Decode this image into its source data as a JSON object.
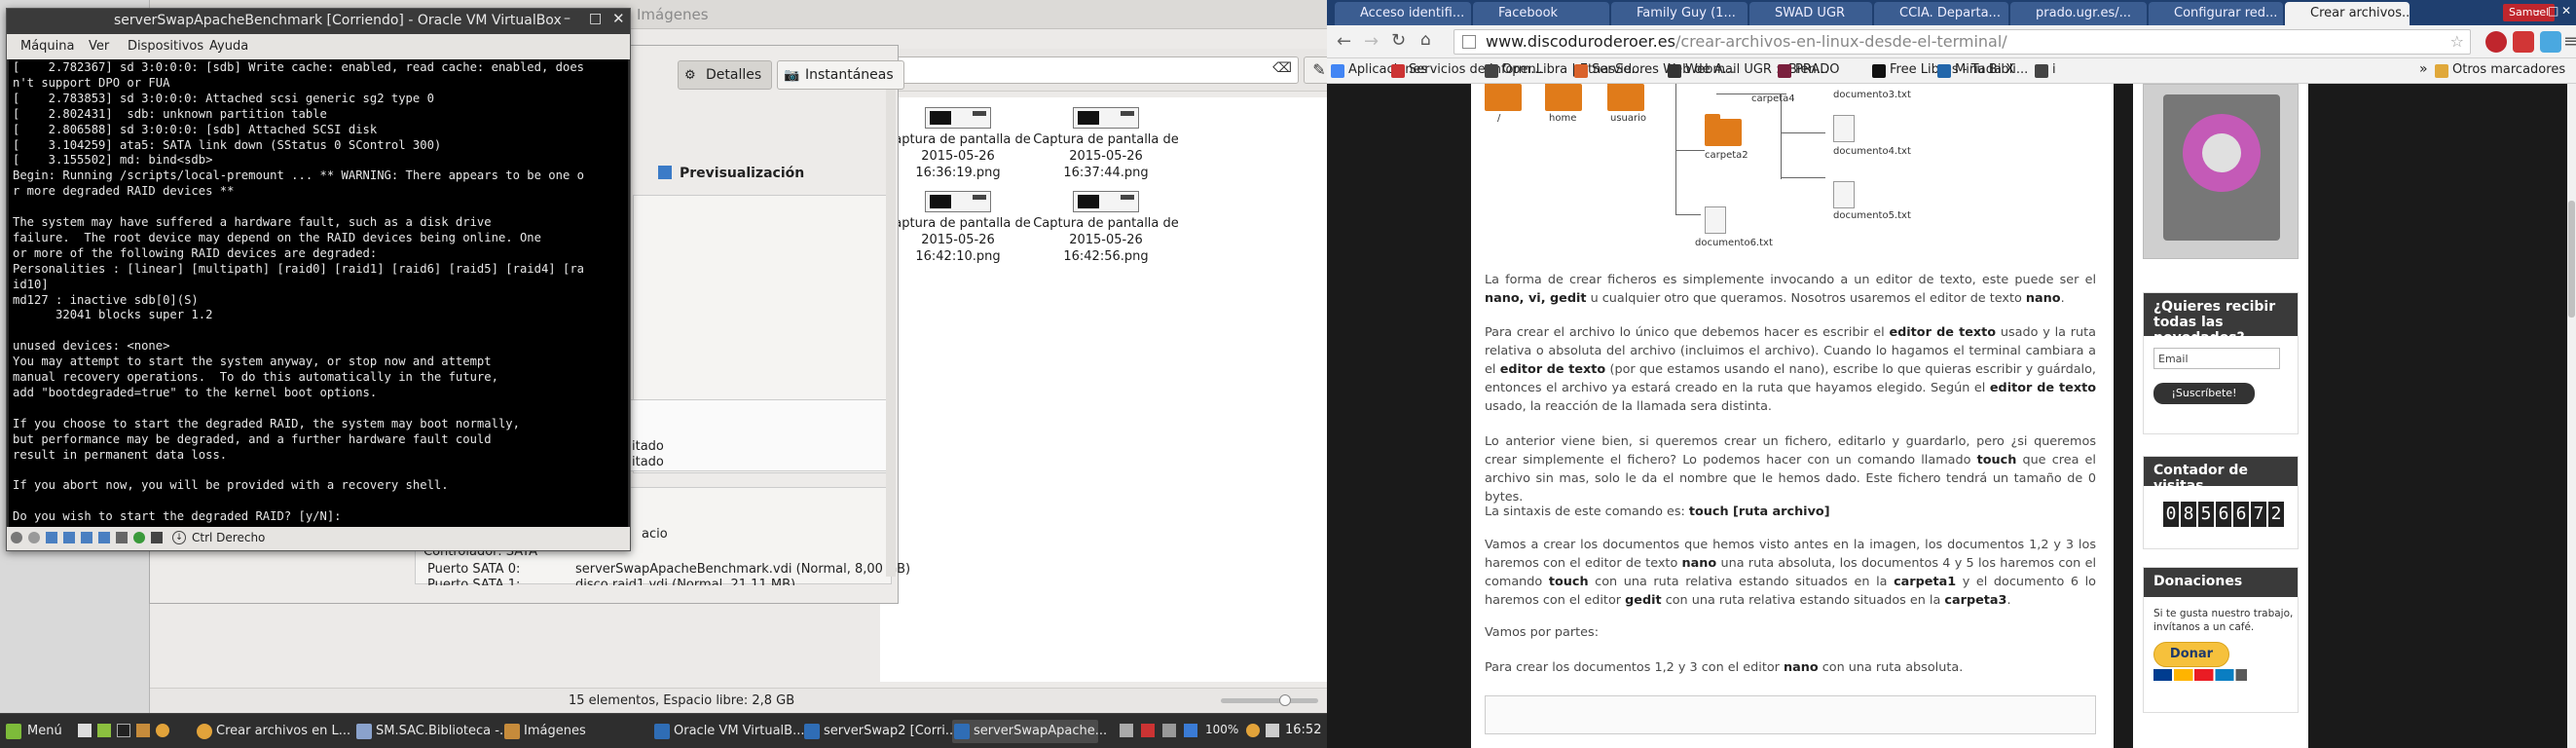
{
  "left_screen": {
    "file_manager": {
      "window_title": "Imágenes",
      "view_buttons": [
        "list-icon",
        "grid-icon",
        "compact-icon"
      ],
      "files": [
        {
          "name": "Captura de pantalla de 2015-05-26 16:36:19.png"
        },
        {
          "name": "Captura de pantalla de 2015-05-26 16:37:44.png"
        },
        {
          "name": "Captura de pantalla de 2015-05-26 16:42:10.png"
        },
        {
          "name": "Captura de pantalla de 2015-05-26 16:42:56.png"
        }
      ],
      "status": "15 elementos, Espacio libre: 2,8 GB"
    },
    "vm_details": {
      "tab_details": "Detalles",
      "tab_snapshots": "Instantáneas",
      "preview_label": "Previsualización",
      "storage": {
        "state1": "itado",
        "state2": "itado",
        "host": "acio",
        "controller": "Controlador: SATA",
        "port0_label": "Puerto SATA 0:",
        "port0_value": "serverSwapApacheBenchmark.vdi (Normal, 8,00 GB)",
        "port1_label": "Puerto SATA 1:",
        "port1_value": "disco raid1.vdi (Normal, 21,11 MB)"
      }
    },
    "vm_window": {
      "title": "serverSwapApacheBenchmark [Corriendo] - Oracle VM VirtualBox",
      "menu": [
        "Máquina",
        "Ver",
        "Dispositivos",
        "Ayuda"
      ],
      "console_lines": [
        "[    2.782367] sd 3:0:0:0: [sdb] Write cache: enabled, read cache: enabled, does",
        "n't support DPO or FUA",
        "[    2.783853] sd 3:0:0:0: Attached scsi generic sg2 type 0",
        "[    2.802431]  sdb: unknown partition table",
        "[    2.806588] sd 3:0:0:0: [sdb] Attached SCSI disk",
        "[    3.104259] ata5: SATA link down (SStatus 0 SControl 300)",
        "[    3.155502] md: bind<sdb>",
        "Begin: Running /scripts/local-premount ... ** WARNING: There appears to be one o",
        "r more degraded RAID devices **",
        "",
        "The system may have suffered a hardware fault, such as a disk drive",
        "failure.  The root device may depend on the RAID devices being online. One",
        "or more of the following RAID devices are degraded:",
        "Personalities : [linear] [multipath] [raid0] [raid1] [raid6] [raid5] [raid4] [ra",
        "id10]",
        "md127 : inactive sdb[0](S)",
        "      32041 blocks super 1.2",
        "",
        "unused devices: <none>",
        "You may attempt to start the system anyway, or stop now and attempt",
        "manual recovery operations.  To do this automatically in the future,",
        "add \"bootdegraded=true\" to the kernel boot options.",
        "",
        "If you choose to start the degraded RAID, the system may boot normally,",
        "but performance may be degraded, and a further hardware fault could",
        "result in permanent data loss.",
        "",
        "If you abort now, you will be provided with a recovery shell.",
        "",
        "Do you wish to start the degraded RAID? [y/N]:"
      ],
      "host_key": "Ctrl Derecho"
    },
    "taskbar": {
      "menu_label": "Menú",
      "items": [
        "Crear archivos en L...",
        "SM.SAC.Biblioteca -...",
        "Imágenes",
        "Oracle VM VirtualB...",
        "serverSwap2 [Corri...",
        "serverSwapApache..."
      ],
      "battery": "100%",
      "clock": "16:52"
    }
  },
  "browser": {
    "tabs": [
      "Acceso identifi...",
      "Facebook",
      "Family Guy (1...",
      "SWAD UGR",
      "CCIA. Departa...",
      "prado.ugr.es/...",
      "Configurar red...",
      "Crear archivos..."
    ],
    "profile": "Samuel",
    "url_domain": "www.discoduroderoer.es",
    "url_path": "/crear-archivos-en-linux-desde-el-terminal/",
    "bookmarks": [
      "Aplicaciones",
      "Servicios de Inform...",
      "OpenLibra | EtnasSe...",
      "Servidores Web de A...",
      "Webmail UGR :: Bien...",
      "PRADO",
      "Free Libros - Tu Bibli...",
      "Miriada X",
      "i"
    ],
    "other_bookmarks": "Otros marcadores",
    "diagram": {
      "folders": [
        "/",
        "home",
        "usuario",
        "carpeta2"
      ],
      "labels": [
        "carpeta4",
        "documento3.txt",
        "documento4.txt",
        "documento5.txt",
        "documento6.txt"
      ]
    },
    "article": {
      "p1_a": "La forma de crear ficheros es simplemente invocando a un editor de texto, este puede ser el ",
      "p1_b": "nano, vi, gedit",
      "p1_c": " u cualquier otro que queramos. Nosotros usaremos el editor de texto ",
      "p1_d": "nano",
      "p1_e": ".",
      "p2_a": "Para crear el archivo lo único que debemos hacer es escribir el ",
      "p2_b": "editor de texto",
      "p2_c": " usado y la ruta relativa o absoluta del archivo (incluimos el archivo). Cuando lo hagamos el terminal cambiara a el ",
      "p2_d": "editor de texto",
      "p2_e": " (por que estamos usando el nano), escribe lo que quieras escribir y guárdalo, entonces el archivo ya estará creado en la ruta que hayamos elegido. Según el ",
      "p2_f": "editor de texto",
      "p2_g": " usado, la reacción de la llamada sera distinta.",
      "p3_a": "Lo anterior viene bien, si queremos crear un fichero, editarlo y guardarlo, pero ¿si queremos crear simplemente el fichero? Lo podemos hacer con un comando llamado ",
      "p3_b": "touch",
      "p3_c": " que crea el archivo sin mas, solo le da el nombre que le hemos dado. Este fichero tendrá un tamaño de 0 bytes.",
      "p4_a": "La sintaxis de este comando es: ",
      "p4_b": "touch [ruta archivo]",
      "p5_a": "Vamos a crear los documentos que hemos visto antes en la imagen, los documentos 1,2 y 3 los haremos con el editor de texto ",
      "p5_b": "nano",
      "p5_c": " una ruta absoluta, los documentos 4 y 5 los haremos con el comando ",
      "p5_d": "touch",
      "p5_e": " con una ruta relativa estando situados en la ",
      "p5_f": "carpeta1",
      "p5_g": "  y el documento 6 lo haremos con el editor ",
      "p5_h": "gedit",
      "p5_i": " con una ruta relativa estando situados en la ",
      "p5_j": "carpeta3",
      "p5_k": ".",
      "p6": "Vamos por partes:",
      "p7_a": "Para crear los documentos 1,2 y 3 con el editor ",
      "p7_b": "nano",
      "p7_c": " con una ruta absoluta."
    },
    "sidebar": {
      "newsletter_title": "¿Quieres recibir todas las novedades?",
      "email_placeholder": "Email",
      "subscribe_label": "¡Suscríbete!",
      "visits_title": "Contador de visitas",
      "visits_digits": [
        "0",
        "8",
        "5",
        "6",
        "6",
        "7",
        "2"
      ],
      "donate_title": "Donaciones",
      "donate_text": "Si te gusta nuestro trabajo, invítanos a un café.",
      "donate_button": "Donar"
    }
  },
  "colors": {
    "accent_blue": "#1f3f6f",
    "orange_folder": "#e07b1a",
    "paypal_yellow": "#f6c13c"
  }
}
